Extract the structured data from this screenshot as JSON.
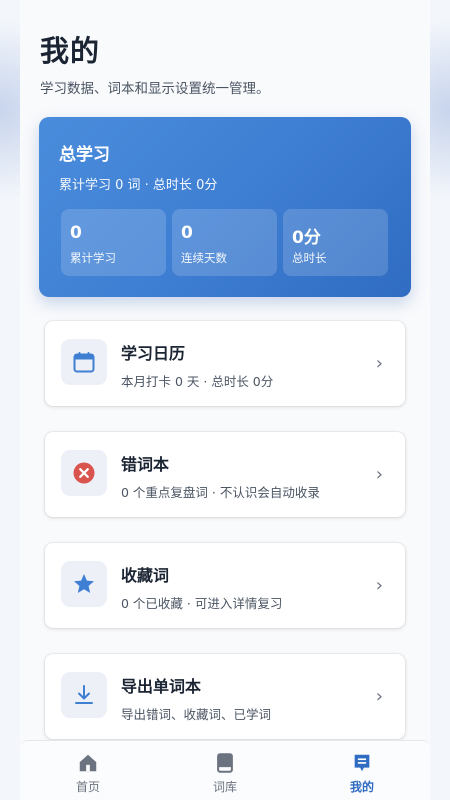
{
  "header": {
    "title": "我的",
    "subtitle": "学习数据、词本和显示设置统一管理。"
  },
  "stats": {
    "title": "总学习",
    "summary": "累计学习 0 词 · 总时长 0分",
    "items": [
      {
        "value": "0",
        "label": "累计学习"
      },
      {
        "value": "0",
        "label": "连续天数"
      },
      {
        "value": "0分",
        "label": "总时长"
      }
    ]
  },
  "menu": [
    {
      "title": "学习日历",
      "subtitle": "本月打卡 0 天 · 总时长 0分",
      "icon": "calendar-icon"
    },
    {
      "title": "错词本",
      "subtitle": "0 个重点复盘词 · 不认识会自动收录",
      "icon": "error-circle-icon"
    },
    {
      "title": "收藏词",
      "subtitle": "0 个已收藏 · 可进入详情复习",
      "icon": "star-icon"
    },
    {
      "title": "导出单词本",
      "subtitle": "导出错词、收藏词、已学词",
      "icon": "download-icon"
    }
  ],
  "chevron": "›",
  "tabs": [
    {
      "label": "首页",
      "icon": "home-icon",
      "active": false
    },
    {
      "label": "词库",
      "icon": "book-icon",
      "active": false
    },
    {
      "label": "我的",
      "icon": "profile-card-icon",
      "active": true
    }
  ],
  "colors": {
    "accent": "#2f6cc2",
    "card_gradient_start": "#4a8cdc",
    "error_red": "#d9534f",
    "icon_blue": "#3f7fd3"
  }
}
